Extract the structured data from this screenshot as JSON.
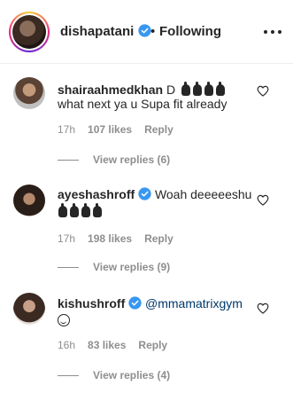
{
  "post": {
    "username": "dishapatani",
    "separator": "•",
    "follow_status": "Following"
  },
  "comments": [
    {
      "username": "shairaahmedkhan",
      "text_prefix": "D",
      "text_line2": "what next ya u Supa fit already",
      "time": "17h",
      "likes": "107 likes",
      "reply_label": "Reply",
      "view_replies": "View replies (6)"
    },
    {
      "username": "ayeshashroff",
      "text": "Woah deeeeeshu",
      "time": "17h",
      "likes": "198 likes",
      "reply_label": "Reply",
      "view_replies": "View replies (9)"
    },
    {
      "username": "kishushroff",
      "text": "@mmamatrixgym",
      "time": "16h",
      "likes": "83 likes",
      "reply_label": "Reply",
      "view_replies": "View replies (4)"
    }
  ],
  "icons": {
    "verified": "verified-badge-icon",
    "more": "more-options-icon",
    "like": "heart-icon",
    "hand": "raised-fist-icon",
    "smile": "grinning-face-icon"
  },
  "colors": {
    "text": "#262626",
    "secondary": "#8e8e8e",
    "verified": "#3897f0",
    "mention": "#00376b"
  }
}
